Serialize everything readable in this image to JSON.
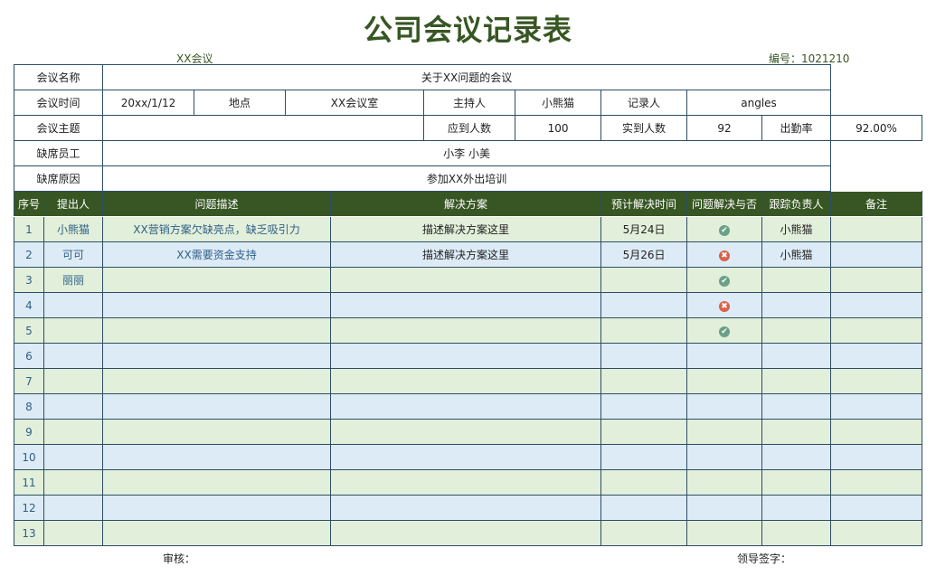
{
  "title": "公司会议记录表",
  "meeting_name_top": "XX会议",
  "number_label": "编号：1021210",
  "info": {
    "name_label": "会议名称",
    "name_value": "关于XX问题的会议",
    "time_label": "会议时间",
    "time_value": "20xx/1/12",
    "place_label": "地点",
    "place_value": "XX会议室",
    "host_label": "主持人",
    "host_value": "小熊猫",
    "recorder_label": "记录人",
    "recorder_value": "angles",
    "topic_label": "会议主题",
    "expected_label": "应到人数",
    "expected_value": "100",
    "actual_label": "实到人数",
    "actual_value": "92",
    "rate_label": "出勤率",
    "rate_value": "92.00%",
    "absent_label": "缺席员工",
    "absent_value": "小李 小美",
    "reason_label": "缺席原因",
    "reason_value": "参加XX外出培训"
  },
  "headers": [
    "序号",
    "提出人",
    "问题描述",
    "解决方案",
    "预计解决时间",
    "问题解决与否",
    "跟踪负责人",
    "备注"
  ],
  "rows": [
    {
      "seq": "1",
      "proposer": "小熊猫",
      "desc": "XX营销方案欠缺亮点，缺乏吸引力",
      "solution": "描述解决方案这里",
      "date": "5月24日",
      "status": "ok",
      "owner": "小熊猫",
      "note": ""
    },
    {
      "seq": "2",
      "proposer": "可可",
      "desc": "XX需要资金支持",
      "solution": "描述解决方案这里",
      "date": "5月26日",
      "status": "bad",
      "owner": "小熊猫",
      "note": ""
    },
    {
      "seq": "3",
      "proposer": "丽丽",
      "desc": "",
      "solution": "",
      "date": "",
      "status": "ok",
      "owner": "",
      "note": ""
    },
    {
      "seq": "4",
      "proposer": "",
      "desc": "",
      "solution": "",
      "date": "",
      "status": "bad",
      "owner": "",
      "note": ""
    },
    {
      "seq": "5",
      "proposer": "",
      "desc": "",
      "solution": "",
      "date": "",
      "status": "ok",
      "owner": "",
      "note": ""
    },
    {
      "seq": "6",
      "proposer": "",
      "desc": "",
      "solution": "",
      "date": "",
      "status": "",
      "owner": "",
      "note": ""
    },
    {
      "seq": "7",
      "proposer": "",
      "desc": "",
      "solution": "",
      "date": "",
      "status": "",
      "owner": "",
      "note": ""
    },
    {
      "seq": "8",
      "proposer": "",
      "desc": "",
      "solution": "",
      "date": "",
      "status": "",
      "owner": "",
      "note": ""
    },
    {
      "seq": "9",
      "proposer": "",
      "desc": "",
      "solution": "",
      "date": "",
      "status": "",
      "owner": "",
      "note": ""
    },
    {
      "seq": "10",
      "proposer": "",
      "desc": "",
      "solution": "",
      "date": "",
      "status": "",
      "owner": "",
      "note": ""
    },
    {
      "seq": "11",
      "proposer": "",
      "desc": "",
      "solution": "",
      "date": "",
      "status": "",
      "owner": "",
      "note": ""
    },
    {
      "seq": "12",
      "proposer": "",
      "desc": "",
      "solution": "",
      "date": "",
      "status": "",
      "owner": "",
      "note": ""
    },
    {
      "seq": "13",
      "proposer": "",
      "desc": "",
      "solution": "",
      "date": "",
      "status": "",
      "owner": "",
      "note": ""
    }
  ],
  "footer": {
    "review": "审核：",
    "sign": "领导签字："
  },
  "colors": {
    "header_bg": "#375623",
    "row_green": "#e2efda",
    "row_blue": "#ddebf7",
    "ok_icon": "#6aa087",
    "bad_icon": "#d9624a"
  },
  "icons": {
    "ok": "check-circle-icon",
    "bad": "cross-circle-icon"
  }
}
